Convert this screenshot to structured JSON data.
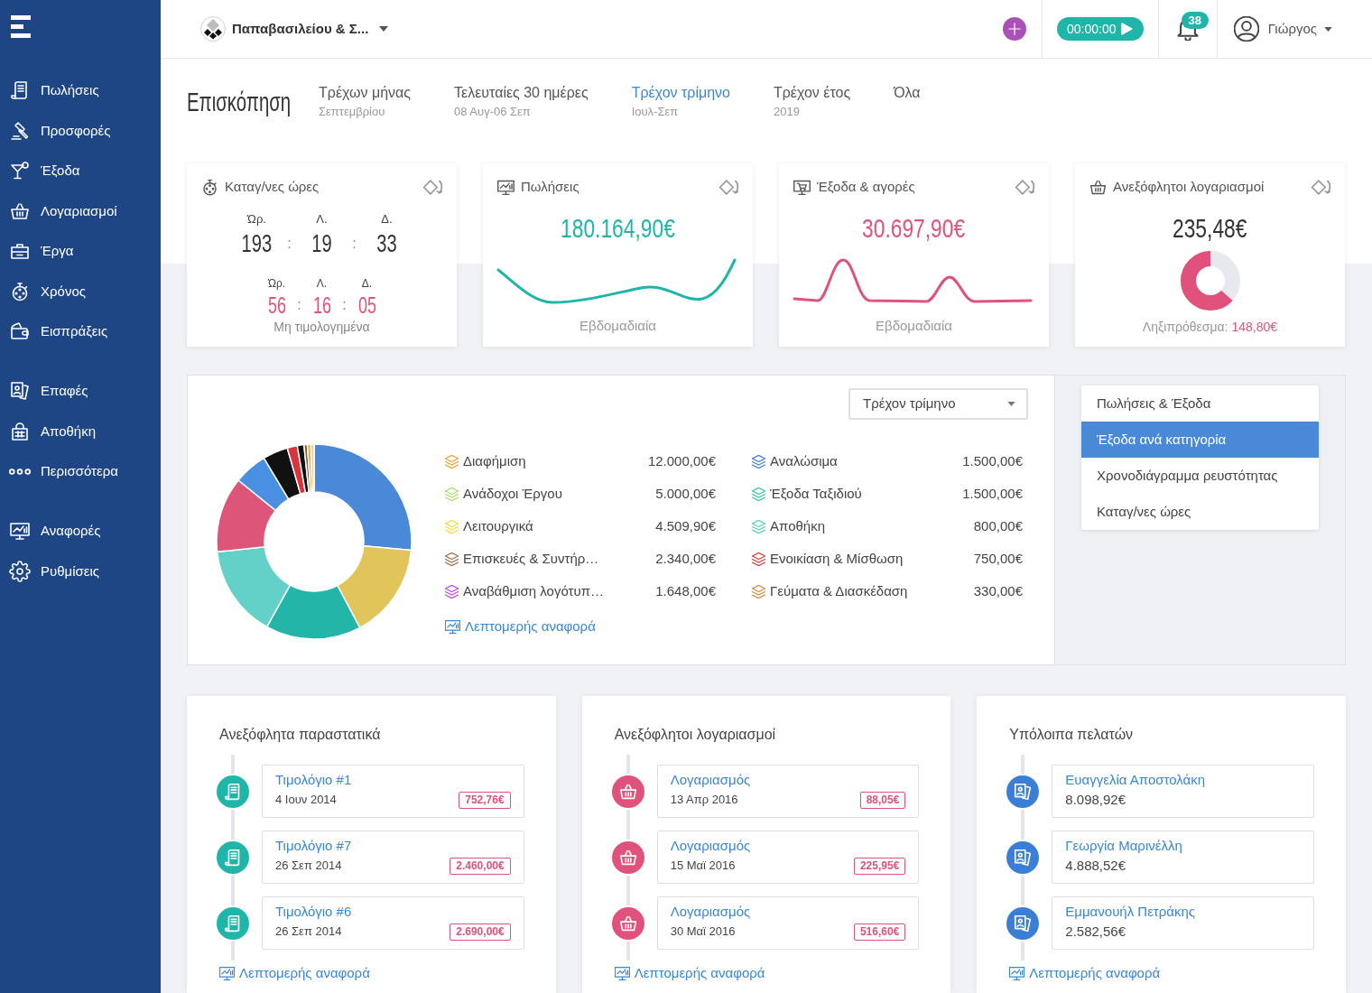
{
  "sidebar": {
    "sections": [
      {
        "items": [
          {
            "label": "Πωλήσεις"
          },
          {
            "label": "Προσφορές"
          },
          {
            "label": "Έξοδα"
          },
          {
            "label": "Λογαριασμοί"
          },
          {
            "label": "Έργα"
          },
          {
            "label": "Χρόνος"
          },
          {
            "label": "Εισπράξεις"
          }
        ]
      },
      {
        "items": [
          {
            "label": "Επαφές"
          },
          {
            "label": "Αποθήκη"
          },
          {
            "label": "Περισσότερα"
          }
        ]
      },
      {
        "items": [
          {
            "label": "Αναφορές"
          },
          {
            "label": "Ρυθμίσεις"
          }
        ]
      }
    ]
  },
  "topbar": {
    "company": "Παπαβασιλείου & Σ...",
    "timer": "00:00:00",
    "notifications": "38",
    "user": "Γιώργος"
  },
  "overview": {
    "title": "Επισκόπηση",
    "periods": [
      {
        "label": "Τρέχων μήνας",
        "range": "Σεπτεμβρίου",
        "selected": false
      },
      {
        "label": "Τελευταίες 30 ημέρες",
        "range": "08 Αυγ-06 Σεπ",
        "selected": false
      },
      {
        "label": "Τρέχον τρίμηνο",
        "range": "Ιουλ-Σεπ",
        "selected": true
      },
      {
        "label": "Τρέχον έτος",
        "range": "2019",
        "selected": false
      },
      {
        "label": "Όλα",
        "selected": false
      }
    ]
  },
  "summary_cards": [
    {
      "kind": "hours",
      "title": "Καταγ/νες ώρες",
      "total": {
        "units": [
          "Ώρ.",
          "Λ.",
          "Δ."
        ],
        "values": [
          "193",
          "19",
          "33"
        ],
        "separators": [
          ":",
          ":"
        ]
      },
      "unbilled": {
        "units": [
          "Ώρ.",
          "Λ.",
          "Δ."
        ],
        "values": [
          "56",
          "16",
          "05"
        ],
        "separators": [
          ":",
          ":"
        ]
      },
      "caption": "Μη τιμολογημένα"
    },
    {
      "kind": "wave",
      "title": "Πωλήσεις",
      "amount": "180.164,90€",
      "color": "#1fb5a8",
      "caption": "Εβδομαδιαία"
    },
    {
      "kind": "spikes",
      "title": "Έξοδα & αγορές",
      "amount": "30.697,90€",
      "color": "#e0527b",
      "caption": "Εβδομαδιαία"
    },
    {
      "kind": "ring",
      "title": "Ανεξόφλητοι λογαριασμοί",
      "amount": "235,48€",
      "level": 0.63,
      "overdue_label": "Ληξιπρόθεσμα:",
      "overdue_amount": "148,80€"
    }
  ],
  "expenses_panel": {
    "period_select": "Τρέχον τρίμηνο",
    "categories": [
      {
        "label": "Διαφήμιση",
        "amount": "12.000,00€",
        "color": "#f0a030"
      },
      {
        "label": "Ανάδοχοι Έργου",
        "amount": "5.000,00€",
        "color": "#a8dc6a"
      },
      {
        "label": "Λειτουργικά",
        "amount": "4.509,90€",
        "color": "#f2dc3a"
      },
      {
        "label": "Επισκευές & Συντήρ…",
        "amount": "2.340,00€",
        "color": "#9b6b4a"
      },
      {
        "label": "Αναβάθμιση λογότυπ…",
        "amount": "1.648,00€",
        "color": "#c244e0"
      },
      {
        "label": "Αναλώσιμα",
        "amount": "1.500,00€",
        "color": "#3a7fe0"
      },
      {
        "label": "Έξοδα Ταξιδιού",
        "amount": "1.500,00€",
        "color": "#2ec4b6"
      },
      {
        "label": "Αποθήκη",
        "amount": "800,00€",
        "color": "#4fcfb4"
      },
      {
        "label": "Ενοικίαση & Μίσθωση",
        "amount": "750,00€",
        "color": "#e03a3a"
      },
      {
        "label": "Γεύματα & Διασκέδαση",
        "amount": "330,00€",
        "color": "#d9853b"
      }
    ],
    "report_link": "Λεπτομερής αναφορά",
    "views": [
      {
        "label": "Πωλήσεις & Έξοδα",
        "selected": false
      },
      {
        "label": "Έξοδα ανά κατηγορία",
        "selected": true
      },
      {
        "label": "Χρονοδιάγραμμα ρευστότητας",
        "selected": false
      },
      {
        "label": "Καταγ/νες ώρες",
        "selected": false
      }
    ]
  },
  "lists": [
    {
      "kind": "invoices",
      "title": "Ανεξόφλητα παραστατικά",
      "color": "#1fb5a8",
      "entries": [
        {
          "title": "Τιμολόγιο #1",
          "date": "4 Ιουν 2014",
          "amount": "752,76€"
        },
        {
          "title": "Τιμολόγιο #7",
          "date": "26 Σεπ 2014",
          "amount": "2.460,00€"
        },
        {
          "title": "Τιμολόγιο #6",
          "date": "26 Σεπ 2014",
          "amount": "2.690,00€"
        }
      ],
      "report_link": "Λεπτομερής αναφορά"
    },
    {
      "kind": "bills",
      "title": "Ανεξόφλητοι λογαριασμοί",
      "color": "#e0527b",
      "entries": [
        {
          "title": "Λογαριασμός",
          "date": "13 Απρ 2016",
          "amount": "88,05€"
        },
        {
          "title": "Λογαριασμός",
          "date": "15 Μαϊ 2016",
          "amount": "225,95€"
        },
        {
          "title": "Λογαριασμός",
          "date": "30 Μαϊ 2016",
          "amount": "516,60€"
        }
      ],
      "report_link": "Λεπτομερής αναφορά"
    },
    {
      "kind": "customers",
      "title": "Υπόλοιπα πελατών",
      "color": "#3a7fd5",
      "entries": [
        {
          "title": "Ευαγγελία Αποστολάκη",
          "balance": "8.098,92€"
        },
        {
          "title": "Γεωργία Μαρινέλλη",
          "balance": "4.888,52€"
        },
        {
          "title": "Εμμανουήλ Πετράκης",
          "balance": "2.582,56€"
        }
      ],
      "report_link": "Λεπτομερής αναφορά"
    }
  ]
}
